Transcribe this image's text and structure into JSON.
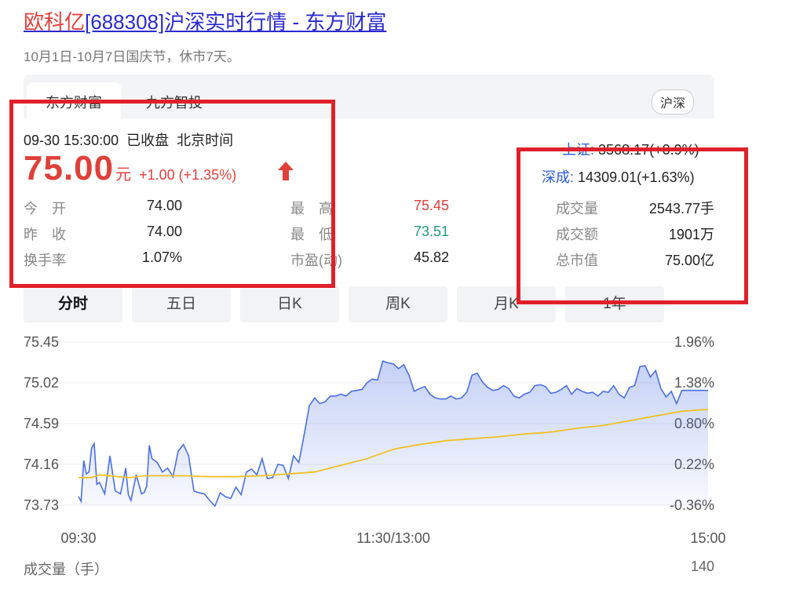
{
  "header": {
    "title_name": "欧科亿",
    "title_rest": "[688308]沪深实时行情 - 东方财富",
    "notice": "10月1日-10月7日国庆节，休市7天。"
  },
  "tabs": [
    {
      "label": "东方财富",
      "active": true
    },
    {
      "label": "九方智投",
      "active": false
    }
  ],
  "market_pill": "沪深",
  "quote": {
    "time": "09-30 15:30:00",
    "status": "已收盘",
    "zone": "北京时间",
    "price": "75.00",
    "unit": "元",
    "change": "+1.00 (+1.35%)",
    "direction": "up"
  },
  "stats": {
    "open_label": "今　开",
    "open": "74.00",
    "prev_label": "昨　收",
    "prev": "74.00",
    "turnover_rate_label": "换手率",
    "turnover_rate": "1.07%",
    "high_label": "最　高",
    "high": "75.45",
    "low_label": "最　低",
    "low": "73.51",
    "pe_label": "市盈(动)",
    "pe": "45.82",
    "volume_label": "成交量",
    "volume": "2543.77手",
    "amount_label": "成交额",
    "amount": "1901万",
    "mktcap_label": "总市值",
    "mktcap": "75.00亿"
  },
  "indices": [
    {
      "name": "上证:",
      "value": "3568.17(+0.9%)"
    },
    {
      "name": "深成:",
      "value": "14309.01(+1.63%)"
    }
  ],
  "period_tabs": [
    {
      "label": "分时",
      "active": true
    },
    {
      "label": "五日",
      "active": false
    },
    {
      "label": "日K",
      "active": false
    },
    {
      "label": "周K",
      "active": false
    },
    {
      "label": "月K",
      "active": false
    },
    {
      "label": "1年",
      "active": false
    }
  ],
  "volume_section": {
    "label": "成交量（手）",
    "max": "140"
  },
  "colors": {
    "up": "#e0403a",
    "down": "#1f9c7a",
    "price_line": "#4a6fe3",
    "avg_line": "#f0c020",
    "annotation": "#e0202a"
  },
  "chart_data": {
    "type": "line",
    "title": "",
    "ylim": [
      73.73,
      75.45
    ],
    "y_ticks_left": [
      "75.45",
      "75.02",
      "74.59",
      "74.16",
      "73.73"
    ],
    "y_ticks_right": [
      "1.96%",
      "1.38%",
      "0.80%",
      "0.22%",
      "-0.36%"
    ],
    "x_ticks": [
      "09:30",
      "11:30/13:00",
      "15:00"
    ],
    "session_minutes": 240,
    "x_tick_minutes": [
      0,
      120,
      240
    ],
    "series": [
      {
        "role": "price",
        "x": [
          0,
          1,
          2,
          3,
          4,
          5,
          6,
          7,
          8,
          10,
          12,
          14,
          16,
          18,
          19,
          20,
          22,
          24,
          25,
          26,
          27,
          28,
          30,
          32,
          34,
          36,
          38,
          40,
          42,
          44,
          46,
          48,
          50,
          52,
          54,
          56,
          58,
          60,
          62,
          64,
          66,
          68,
          70,
          72,
          74,
          76,
          78,
          80,
          82,
          84,
          86,
          88,
          90,
          92,
          94,
          96,
          98,
          100,
          102,
          104,
          106,
          108,
          110,
          112,
          114,
          116,
          118,
          120,
          122,
          124,
          126,
          128,
          130,
          132,
          134,
          136,
          138,
          140,
          142,
          144,
          146,
          148,
          150,
          152,
          154,
          156,
          158,
          160,
          162,
          164,
          166,
          168,
          170,
          172,
          174,
          176,
          178,
          180,
          182,
          184,
          186,
          188,
          190,
          192,
          194,
          196,
          198,
          200,
          202,
          204,
          206,
          208,
          210,
          212,
          214,
          216,
          218,
          220,
          222,
          224,
          226,
          228,
          230,
          232,
          234,
          236,
          238,
          240
        ],
        "y": [
          73.82,
          73.77,
          74.2,
          74.06,
          74.08,
          74.33,
          74.38,
          73.95,
          73.97,
          73.85,
          74.25,
          73.88,
          73.85,
          74.12,
          73.84,
          73.78,
          74.05,
          73.85,
          73.86,
          73.93,
          74.36,
          74.22,
          74.18,
          74.08,
          74.12,
          74.03,
          74.3,
          74.37,
          74.25,
          73.88,
          73.86,
          73.85,
          73.78,
          73.72,
          73.86,
          73.82,
          73.8,
          73.92,
          73.84,
          74.08,
          74.11,
          74.05,
          74.22,
          74.01,
          74.02,
          74.16,
          74.15,
          74.01,
          74.25,
          74.18,
          74.47,
          74.78,
          74.86,
          74.8,
          74.82,
          74.88,
          74.88,
          74.9,
          74.88,
          74.93,
          74.94,
          74.95,
          75.02,
          75.06,
          75.05,
          75.25,
          75.23,
          75.22,
          75.17,
          75.21,
          75.1,
          74.93,
          74.96,
          74.98,
          74.9,
          74.86,
          74.85,
          74.85,
          74.88,
          74.85,
          74.86,
          74.92,
          75.1,
          75.12,
          75.03,
          74.97,
          74.94,
          74.95,
          74.99,
          74.96,
          74.88,
          74.86,
          74.9,
          74.92,
          74.99,
          75.0,
          74.98,
          74.91,
          74.92,
          74.95,
          74.99,
          74.9,
          74.96,
          74.93,
          74.91,
          74.92,
          74.88,
          74.93,
          74.92,
          74.99,
          74.9,
          74.86,
          74.97,
          74.99,
          75.19,
          75.2,
          75.08,
          75.15,
          74.96,
          74.87,
          74.93,
          74.8,
          74.94,
          74.94,
          74.94,
          74.94,
          74.94,
          74.94
        ]
      },
      {
        "role": "average",
        "x": [
          0,
          5,
          8,
          15,
          20,
          25,
          30,
          40,
          50,
          60,
          70,
          80,
          90,
          100,
          110,
          120,
          130,
          140,
          150,
          160,
          170,
          180,
          190,
          200,
          210,
          220,
          230,
          240
        ],
        "y": [
          74.02,
          74.02,
          74.05,
          74.03,
          74.02,
          74.04,
          74.04,
          74.04,
          74.03,
          74.03,
          74.04,
          74.06,
          74.08,
          74.15,
          74.22,
          74.32,
          74.37,
          74.41,
          74.43,
          74.45,
          74.48,
          74.5,
          74.54,
          74.57,
          74.62,
          74.67,
          74.72,
          74.74
        ]
      }
    ]
  }
}
